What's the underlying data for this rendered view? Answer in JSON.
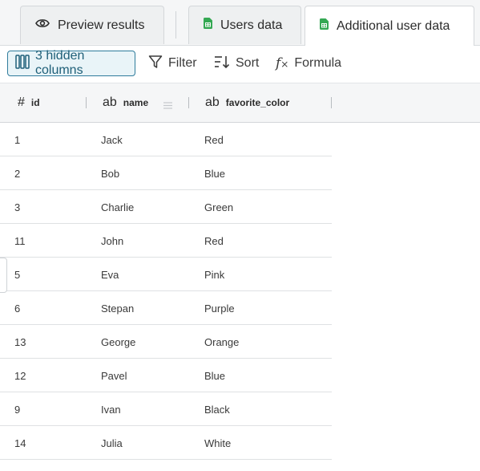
{
  "tabs": [
    {
      "label": "Preview results",
      "icon": "eye-icon",
      "active": false
    },
    {
      "label": "Users data",
      "icon": "spreadsheet-icon",
      "active": false
    },
    {
      "label": "Additional user data",
      "icon": "spreadsheet-icon",
      "active": true
    }
  ],
  "toolbar": {
    "hidden_columns": "3 hidden columns",
    "filter": "Filter",
    "sort": "Sort",
    "formula": "Formula"
  },
  "columns": [
    {
      "type_icon": "#",
      "name": "id"
    },
    {
      "type_icon": "ab",
      "name": "name"
    },
    {
      "type_icon": "ab",
      "name": "favorite_color"
    }
  ],
  "rows": [
    [
      "1",
      "Jack",
      "Red"
    ],
    [
      "2",
      "Bob",
      "Blue"
    ],
    [
      "3",
      "Charlie",
      "Green"
    ],
    [
      "11",
      "John",
      "Red"
    ],
    [
      "5",
      "Eva",
      "Pink"
    ],
    [
      "6",
      "Stepan",
      "Purple"
    ],
    [
      "13",
      "George",
      "Orange"
    ],
    [
      "12",
      "Pavel",
      "Blue"
    ],
    [
      "9",
      "Ivan",
      "Black"
    ],
    [
      "14",
      "Julia",
      "White"
    ]
  ],
  "colors": {
    "accent": "#2f7c9c",
    "sheet_green": "#34a853"
  }
}
